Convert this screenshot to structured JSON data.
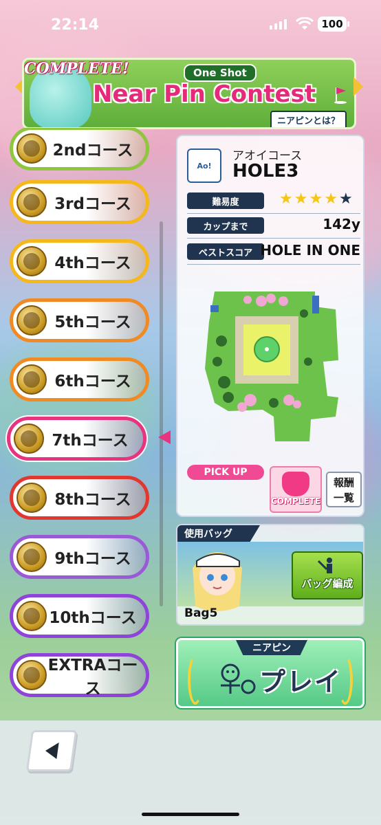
{
  "status_bar": {
    "time": "22:14",
    "battery": "100"
  },
  "banner": {
    "complete": "COMPLETE!",
    "badge": "One Shot",
    "title": "Near Pin Contest",
    "help": "ニアピンとは？"
  },
  "courses": [
    {
      "label": "2ndコース",
      "color": "#8ec63f"
    },
    {
      "label": "3rdコース",
      "color": "#f5b81c"
    },
    {
      "label": "4thコース",
      "color": "#f5b81c"
    },
    {
      "label": "5thコース",
      "color": "#f08a24"
    },
    {
      "label": "6thコース",
      "color": "#f08a24"
    },
    {
      "label": "7thコース",
      "color": "#e8347f"
    },
    {
      "label": "8thコース",
      "color": "#e2372f"
    },
    {
      "label": "9thコース",
      "color": "#9a5ad6"
    },
    {
      "label": "10thコース",
      "color": "#8e44d8"
    },
    {
      "label": "EXTRAコース",
      "color": "#8e44d8"
    }
  ],
  "selected_course": "7thコース",
  "detail": {
    "logo_text": "Ao!",
    "course_name": "アオイコース",
    "hole": "HOLE3",
    "difficulty_label": "難易度",
    "difficulty_stars": 4,
    "difficulty_max": 5,
    "distance_label": "カップまで",
    "distance": "142y",
    "best_label": "ベストスコア",
    "best": "HOLE IN ONE",
    "pickup": "PICK UP",
    "complete_badge": "COMPLETE",
    "reward": "報酬\n一覧"
  },
  "bag": {
    "title": "使用バッグ",
    "edit": "バッグ編成",
    "name": "Bag5"
  },
  "play": {
    "top": "ニアピン",
    "label": "プレイ"
  },
  "colors": {
    "accent_pink": "#e8347f",
    "navy": "#20344f",
    "green": "#5fae3b"
  }
}
